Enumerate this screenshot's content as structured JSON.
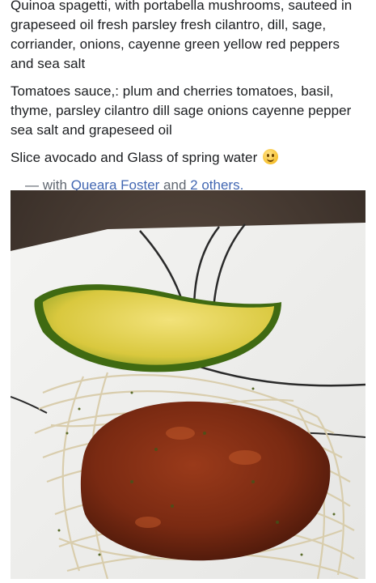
{
  "post": {
    "paragraphs": [
      "Quinoa spagetti, with portabella mushrooms, sauteed in grapeseed oil fresh parsley fresh cilantro, dill, sage, corriander, onions, cayenne green yellow red peppers and sea salt",
      "Tomatoes sauce,: plum and cherries tomatoes, basil, thyme, parsley cilantro dill sage onions cayenne pepper sea salt and grapeseed oil",
      "Slice avocado and Glass of spring water"
    ],
    "emoji_icon": "smiling-face-emoji",
    "tag_prefix": "— with",
    "tagged_person": "Queara Foster",
    "tag_joiner": "and",
    "tagged_others": "2 others.",
    "link_color": "#4267b2"
  }
}
